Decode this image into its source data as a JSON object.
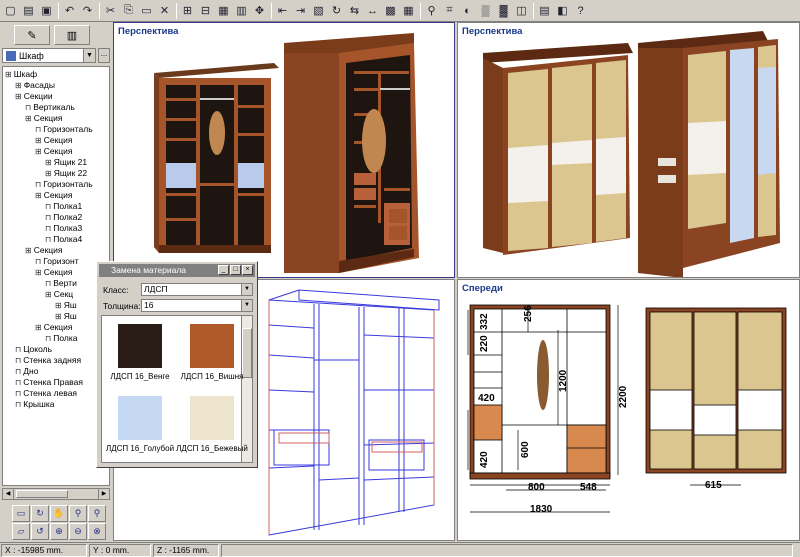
{
  "toolbar": {
    "icons": [
      "new-icon",
      "open-icon",
      "save-icon",
      "undo-icon",
      "redo-icon",
      "cut-icon",
      "copy-icon",
      "paste-icon",
      "delete-icon",
      "group-icon",
      "ungroup-icon",
      "properties-icon",
      "table-icon",
      "move-icon",
      "align-left-icon",
      "align-right-icon",
      "section-icon",
      "rotate-icon",
      "mirror-icon",
      "dimension-icon",
      "frame-icon",
      "grid-icon",
      "zoom-icon",
      "wire-icon",
      "paint-icon",
      "texture-icon",
      "pattern-icon",
      "palette-icon",
      "render-icon",
      "export-icon",
      "help-icon"
    ]
  },
  "left_panel": {
    "combo_value": "Шкаф",
    "combo_button": "...",
    "tree": [
      {
        "label": "Шкаф",
        "level": 0,
        "icon": "folder-icon"
      },
      {
        "label": "Фасады",
        "level": 1,
        "icon": "folder-icon"
      },
      {
        "label": "Секции",
        "level": 1,
        "icon": "folder-icon"
      },
      {
        "label": "Вертикаль",
        "level": 2,
        "icon": "panel-icon"
      },
      {
        "label": "Секция",
        "level": 2,
        "icon": "folder-icon"
      },
      {
        "label": "Горизонталь",
        "level": 3,
        "icon": "panel-icon"
      },
      {
        "label": "Секция",
        "level": 3,
        "icon": "folder-icon"
      },
      {
        "label": "Секция",
        "level": 3,
        "icon": "folder-icon"
      },
      {
        "label": "Ящик 21",
        "level": 4,
        "icon": "folder-icon"
      },
      {
        "label": "Ящик 22",
        "level": 4,
        "icon": "folder-icon"
      },
      {
        "label": "Горизонталь",
        "level": 3,
        "icon": "panel-icon"
      },
      {
        "label": "Секция",
        "level": 3,
        "icon": "folder-icon"
      },
      {
        "label": "Полка1",
        "level": 4,
        "icon": "panel-icon"
      },
      {
        "label": "Полка2",
        "level": 4,
        "icon": "panel-icon"
      },
      {
        "label": "Полка3",
        "level": 4,
        "icon": "panel-icon"
      },
      {
        "label": "Полка4",
        "level": 4,
        "icon": "panel-icon"
      },
      {
        "label": "Секция",
        "level": 2,
        "icon": "folder-icon"
      },
      {
        "label": "Горизонт",
        "level": 3,
        "icon": "panel-icon"
      },
      {
        "label": "Секция",
        "level": 3,
        "icon": "folder-icon"
      },
      {
        "label": "Верти",
        "level": 4,
        "icon": "panel-icon"
      },
      {
        "label": "Секц",
        "level": 4,
        "icon": "folder-icon"
      },
      {
        "label": "Яш",
        "level": 5,
        "icon": "folder-icon"
      },
      {
        "label": "Яш",
        "level": 5,
        "icon": "folder-icon"
      },
      {
        "label": "Секция",
        "level": 3,
        "icon": "folder-icon"
      },
      {
        "label": "Полка",
        "level": 4,
        "icon": "panel-icon"
      },
      {
        "label": "Цоколь",
        "level": 1,
        "icon": "panel-icon"
      },
      {
        "label": "Стенка задняя",
        "level": 1,
        "icon": "panel-icon"
      },
      {
        "label": "Дно",
        "level": 1,
        "icon": "panel-icon"
      },
      {
        "label": "Стенка Правая",
        "level": 1,
        "icon": "panel-icon"
      },
      {
        "label": "Стенка левая",
        "level": 1,
        "icon": "panel-icon"
      },
      {
        "label": "Крышка",
        "level": 1,
        "icon": "panel-icon"
      }
    ]
  },
  "viewports": {
    "top_left_title": "Перспектива",
    "top_right_title": "Перспектива",
    "bottom_right_title": "Спереди"
  },
  "front_view_dims": {
    "d256": "256",
    "d332": "332",
    "d220": "220",
    "d1200": "1200",
    "d2200": "2200",
    "d420a": "420",
    "d600": "600",
    "d420b": "420",
    "d800": "800",
    "d548": "548",
    "d1830": "1830",
    "d615": "615"
  },
  "dialog": {
    "title": "Замена материала",
    "class_label": "Класс:",
    "class_value": "ЛДСП",
    "thickness_label": "Толщина:",
    "thickness_value": "16",
    "materials": [
      {
        "name": "ЛДСП 16_Венге",
        "color": "#2a1c16"
      },
      {
        "name": "ЛДСП 16_Вишня",
        "color": "#b05a2a"
      },
      {
        "name": "ЛДСП 16_Голубой",
        "color": "#c4d8f4"
      },
      {
        "name": "ЛДСП 16_Бежевый",
        "color": "#ece4cc"
      }
    ]
  },
  "status_bar": {
    "x": "X : -15985 mm.",
    "y": "Y : 0 mm.",
    "z": "Z : -1165 mm."
  },
  "colors": {
    "wood": "#8b4422",
    "wood_dark": "#5c2a12",
    "rattan": "#d8c48c",
    "glass": "#c8d8f0",
    "title_blue": "#1a3a8a",
    "wire": "#3a3adc"
  }
}
